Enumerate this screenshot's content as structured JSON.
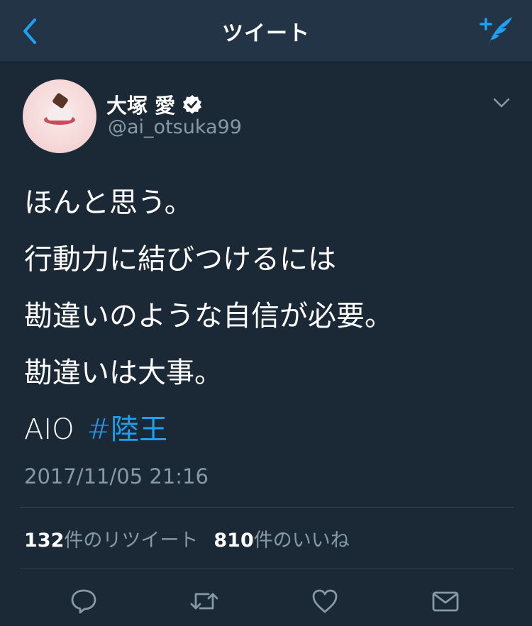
{
  "nav": {
    "title": "ツイート",
    "back_icon": "chevron-left-icon",
    "compose_icon": "compose-tweet-icon"
  },
  "colors": {
    "background": "#1b2836",
    "navbar": "#243447",
    "accent": "#1da1f2",
    "secondary_text": "#8899a6",
    "divider": "#38444d"
  },
  "tweet": {
    "author": {
      "display_name": "大塚 愛",
      "verified_icon": "verified-badge-icon",
      "username": "@ai_otsuka99"
    },
    "lines": [
      "ほんと思う。",
      "行動力に結びつけるには",
      "勘違いのような自信が必要。",
      "勘違いは大事。"
    ],
    "tail_text": "AIO",
    "hashtag": "#陸王",
    "timestamp": "2017/11/05 21:16",
    "stats": {
      "retweet_count": "132",
      "retweet_label": "件のリツイート",
      "like_count": "810",
      "like_label": "件のいいね"
    }
  },
  "actions": [
    {
      "name": "reply-icon"
    },
    {
      "name": "retweet-icon"
    },
    {
      "name": "like-icon"
    },
    {
      "name": "direct-message-icon"
    }
  ]
}
